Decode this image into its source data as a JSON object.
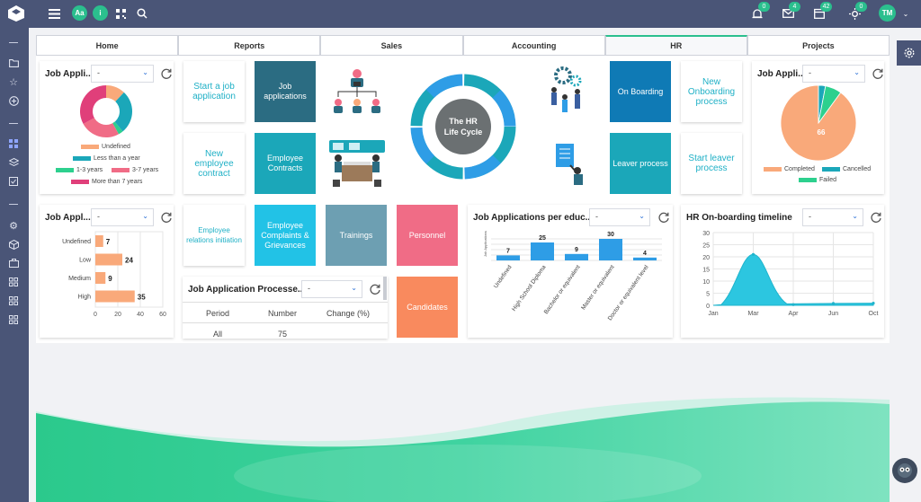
{
  "topbar": {
    "avatar_aa": "Aa",
    "info_icon": "i",
    "notifications_count": "0",
    "messages_count": "4",
    "calendar_count": "42",
    "activity_count": "0",
    "user_initials": "TM"
  },
  "tabs": [
    {
      "label": "Home",
      "active": false
    },
    {
      "label": "Reports",
      "active": false
    },
    {
      "label": "Sales",
      "active": false
    },
    {
      "label": "Accounting",
      "active": false
    },
    {
      "label": "HR",
      "active": true
    },
    {
      "label": "Projects",
      "active": false
    }
  ],
  "select_default": "-",
  "widgets": {
    "donut": {
      "title": "Job Appli...",
      "legend": [
        "Undefined",
        "Less than a year",
        "1-3 years",
        "3-7 years",
        "More than 7 years"
      ],
      "colors": [
        "#f9a97a",
        "#1ba7b9",
        "#2dd08e",
        "#f06c86",
        "#e03f7a"
      ]
    },
    "bars": {
      "title": "Job Appl...",
      "categories": [
        "Undefined",
        "Low",
        "Medium",
        "High"
      ],
      "values": [
        7,
        24,
        9,
        35
      ],
      "ticks": [
        "0",
        "20",
        "40",
        "60"
      ]
    },
    "processes": {
      "title": "Job Application Processe...",
      "columns": [
        "Period",
        "Number",
        "Change (%)"
      ],
      "rows": [
        [
          "All",
          "75",
          ""
        ]
      ]
    },
    "education": {
      "title": "Job Applications per educ...",
      "categories": [
        "Undefined",
        "High School Diploma",
        "Bachelor or equivalent",
        "Master or equivalent",
        "Doctor or equivalent level"
      ],
      "values": [
        7,
        25,
        9,
        30,
        4
      ],
      "y_label": "Job Applications"
    },
    "pie": {
      "title": "Job Appli...",
      "value_label": "66",
      "legend": [
        "Completed",
        "Cancelled",
        "Failed"
      ],
      "colors": [
        "#f9a97a",
        "#1ba7b9",
        "#2dd08e"
      ]
    },
    "timeline": {
      "title": "HR On-boarding timeline",
      "y_ticks": [
        "30",
        "25",
        "20",
        "15",
        "10",
        "5",
        "0"
      ],
      "x_ticks": [
        "Jan",
        "Mar",
        "Apr",
        "Jun",
        "Oct"
      ]
    }
  },
  "tiles": {
    "start_job": "Start a job application",
    "job_applications": "Job applications",
    "new_employee_contract": "New employee contract",
    "employee_contracts": "Employee Contracts",
    "employee_relations": "Employee relations initiation",
    "complaints": "Employee Complaints & Grievances",
    "trainings": "Trainings",
    "personnel": "Personnel",
    "candidates": "Candidates",
    "on_boarding": "On Boarding",
    "new_onboarding": "New Onboarding process",
    "leaver_process": "Leaver process",
    "start_leaver": "Start leaver process"
  },
  "lifecycle": {
    "line1": "The HR",
    "line2": "Life Cycle"
  },
  "colors": {
    "topbar": "#4a5577",
    "accent_green": "#2bbf8e",
    "dark_teal": "#2b6c82",
    "teal": "#1ba7b9",
    "slate": "#6d9fb2",
    "pink": "#f06c86",
    "orange": "#f98a5e",
    "blue": "#0f7ab5",
    "chart_blue": "#2e9de6"
  }
}
